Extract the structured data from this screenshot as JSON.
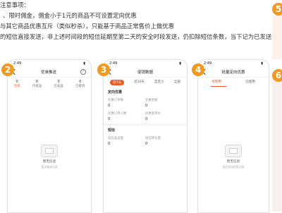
{
  "notes": {
    "line0": "注意事项：",
    "line1": "、限时佣金，佣金小于1元的商品不可设置定向优惠",
    "line2": "与其它商品优惠互斥（类似秒杀），只能基于商品正常售价上做优惠",
    "line3": "的短信直接发送，非上述时间段的短信延期至第二天的安全时段发送，仍扣除短信条数，当下记为已发送"
  },
  "badges": [
    "2",
    "3",
    "4",
    "5",
    "6"
  ],
  "phone2": {
    "time": "2:49",
    "title": "优单推送",
    "stats": [
      {
        "num": "0",
        "label": "全部"
      },
      {
        "num": "0",
        "label": "待发送"
      },
      {
        "num": "0",
        "label": "已发送"
      },
      {
        "num": "0",
        "label": "已取消"
      }
    ],
    "empty_title": "暂无信息",
    "empty_desc": "暂无推送记录"
  },
  "phone3": {
    "time": "2:49",
    "title": "促销数据",
    "tabs": [
      "近7天",
      "近30天",
      "自定义",
      "全部"
    ],
    "section1": "定向优惠",
    "labels_a": [
      "优惠订单数",
      "优惠金额"
    ],
    "values_a": [
      "0",
      "0"
    ],
    "labels_b": [
      "优惠订单人数",
      "优惠客单价"
    ],
    "values_b": [
      "0",
      "0"
    ],
    "section2": "短信",
    "labels_c": [
      "短信发送量",
      "短信转化量"
    ],
    "values_c": [
      "0",
      "0"
    ]
  },
  "phone4": {
    "time": "2:49",
    "title": "批量定向优惠",
    "tabs": [
      "待使用",
      "已使用"
    ],
    "empty_title": "暂无信息",
    "empty_desc": "暂无定向优惠记录"
  },
  "colors": {
    "accent": "#f05a24",
    "badge": "#f39a1e"
  }
}
